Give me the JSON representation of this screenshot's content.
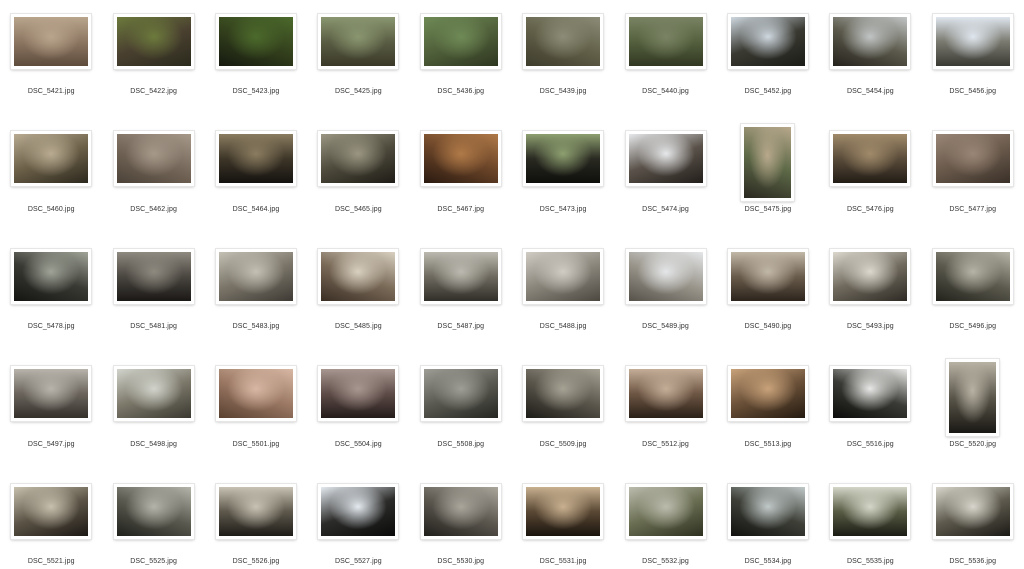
{
  "files": [
    {
      "name": "DSC_5421.jpg",
      "orientation": "landscape",
      "tone": [
        "#b9a48c",
        "#8d7763",
        "#5e4c3c"
      ]
    },
    {
      "name": "DSC_5422.jpg",
      "orientation": "landscape",
      "tone": [
        "#6c7a3c",
        "#4a4030",
        "#2a2a1c"
      ]
    },
    {
      "name": "DSC_5423.jpg",
      "orientation": "landscape",
      "tone": [
        "#4c6a2c",
        "#33401c",
        "#161a10"
      ]
    },
    {
      "name": "DSC_5425.jpg",
      "orientation": "landscape",
      "tone": [
        "#8a9670",
        "#5a5e44",
        "#3a3828"
      ]
    },
    {
      "name": "DSC_5436.jpg",
      "orientation": "landscape",
      "tone": [
        "#6f8a56",
        "#50603a",
        "#2e3620"
      ]
    },
    {
      "name": "DSC_5439.jpg",
      "orientation": "landscape",
      "tone": [
        "#8c8c78",
        "#626048",
        "#3e3c2c"
      ]
    },
    {
      "name": "DSC_5440.jpg",
      "orientation": "landscape",
      "tone": [
        "#7a8464",
        "#54603e",
        "#323822"
      ]
    },
    {
      "name": "DSC_5452.jpg",
      "orientation": "landscape",
      "tone": [
        "#cfd8e0",
        "#3a3a32",
        "#1c1c18"
      ]
    },
    {
      "name": "DSC_5454.jpg",
      "orientation": "landscape",
      "tone": [
        "#c0c4c4",
        "#5c5a4c",
        "#24221c"
      ]
    },
    {
      "name": "DSC_5456.jpg",
      "orientation": "landscape",
      "tone": [
        "#dfe6ee",
        "#7a7a70",
        "#3a3a34"
      ]
    },
    {
      "name": "DSC_5460.jpg",
      "orientation": "landscape",
      "tone": [
        "#b8ab92",
        "#6c6048",
        "#2c281e"
      ]
    },
    {
      "name": "DSC_5462.jpg",
      "orientation": "landscape",
      "tone": [
        "#a6998a",
        "#76685a",
        "#4c4238"
      ]
    },
    {
      "name": "DSC_5464.jpg",
      "orientation": "landscape",
      "tone": [
        "#8a7c60",
        "#3e3628",
        "#141210"
      ]
    },
    {
      "name": "DSC_5465.jpg",
      "orientation": "landscape",
      "tone": [
        "#9a9682",
        "#4e4a3c",
        "#1e1c16"
      ]
    },
    {
      "name": "DSC_5467.jpg",
      "orientation": "landscape",
      "tone": [
        "#b07a48",
        "#6a4428",
        "#2a1a10"
      ]
    },
    {
      "name": "DSC_5473.jpg",
      "orientation": "landscape",
      "tone": [
        "#8ea070",
        "#2a2a22",
        "#0e0e0c"
      ]
    },
    {
      "name": "DSC_5474.jpg",
      "orientation": "landscape",
      "tone": [
        "#e6e8ea",
        "#5a524a",
        "#221e1a"
      ]
    },
    {
      "name": "DSC_5475.jpg",
      "orientation": "portrait",
      "tone": [
        "#b8a88c",
        "#5e6a48",
        "#2a2820"
      ]
    },
    {
      "name": "DSC_5476.jpg",
      "orientation": "landscape",
      "tone": [
        "#a08a6a",
        "#5a4c3a",
        "#221c16"
      ]
    },
    {
      "name": "DSC_5477.jpg",
      "orientation": "landscape",
      "tone": [
        "#9a8676",
        "#6a5a4c",
        "#3a3028"
      ]
    },
    {
      "name": "DSC_5478.jpg",
      "orientation": "landscape",
      "tone": [
        "#a0a498",
        "#3a3a34",
        "#141412"
      ]
    },
    {
      "name": "DSC_5481.jpg",
      "orientation": "landscape",
      "tone": [
        "#8e8a80",
        "#4a4640",
        "#1a1816"
      ]
    },
    {
      "name": "DSC_5483.jpg",
      "orientation": "landscape",
      "tone": [
        "#c4c0b4",
        "#7a7468",
        "#3e3a34"
      ]
    },
    {
      "name": "DSC_5485.jpg",
      "orientation": "landscape",
      "tone": [
        "#d8d0c0",
        "#7a6a58",
        "#3a2e24"
      ]
    },
    {
      "name": "DSC_5487.jpg",
      "orientation": "landscape",
      "tone": [
        "#bcbab0",
        "#6e6a60",
        "#302e28"
      ]
    },
    {
      "name": "DSC_5488.jpg",
      "orientation": "landscape",
      "tone": [
        "#d0ccc4",
        "#8a867c",
        "#4c4840"
      ]
    },
    {
      "name": "DSC_5489.jpg",
      "orientation": "landscape",
      "tone": [
        "#e4e6e8",
        "#9a968c",
        "#56524a"
      ]
    },
    {
      "name": "DSC_5490.jpg",
      "orientation": "landscape",
      "tone": [
        "#c2b8a8",
        "#6a5c4c",
        "#2c241c"
      ]
    },
    {
      "name": "DSC_5493.jpg",
      "orientation": "landscape",
      "tone": [
        "#dcd8ce",
        "#706a5e",
        "#2e2a24"
      ]
    },
    {
      "name": "DSC_5496.jpg",
      "orientation": "landscape",
      "tone": [
        "#b6b4a6",
        "#5c5a4e",
        "#22221c"
      ]
    },
    {
      "name": "DSC_5497.jpg",
      "orientation": "landscape",
      "tone": [
        "#b8b4ac",
        "#6a645c",
        "#34302a"
      ]
    },
    {
      "name": "DSC_5498.jpg",
      "orientation": "landscape",
      "tone": [
        "#d2d4cc",
        "#7c786a",
        "#3a3830"
      ]
    },
    {
      "name": "DSC_5501.jpg",
      "orientation": "landscape",
      "tone": [
        "#d8b8a4",
        "#9a7864",
        "#5a4030"
      ]
    },
    {
      "name": "DSC_5504.jpg",
      "orientation": "landscape",
      "tone": [
        "#a89690",
        "#5e4c48",
        "#241c1a"
      ]
    },
    {
      "name": "DSC_5508.jpg",
      "orientation": "landscape",
      "tone": [
        "#9e9e96",
        "#5a5a52",
        "#262622"
      ]
    },
    {
      "name": "DSC_5509.jpg",
      "orientation": "landscape",
      "tone": [
        "#a6a294",
        "#5a564c",
        "#1e1c18"
      ]
    },
    {
      "name": "DSC_5512.jpg",
      "orientation": "landscape",
      "tone": [
        "#c4ae98",
        "#6e5644",
        "#2a2018"
      ]
    },
    {
      "name": "DSC_5513.jpg",
      "orientation": "landscape",
      "tone": [
        "#c8a27a",
        "#6a5038",
        "#241a10"
      ]
    },
    {
      "name": "DSC_5516.jpg",
      "orientation": "landscape",
      "tone": [
        "#e8e8e6",
        "#3a3a36",
        "#0c0c0a"
      ]
    },
    {
      "name": "DSC_5520.jpg",
      "orientation": "portrait",
      "tone": [
        "#b8b2a4",
        "#5a564a",
        "#1a1814"
      ]
    },
    {
      "name": "DSC_5521.jpg",
      "orientation": "landscape",
      "tone": [
        "#c8c0ae",
        "#5c5446",
        "#1c1814"
      ]
    },
    {
      "name": "DSC_5525.jpg",
      "orientation": "landscape",
      "tone": [
        "#b4b4aa",
        "#5a5a50",
        "#20201c"
      ]
    },
    {
      "name": "DSC_5526.jpg",
      "orientation": "landscape",
      "tone": [
        "#c8c2b4",
        "#5e584c",
        "#1e1c18"
      ]
    },
    {
      "name": "DSC_5527.jpg",
      "orientation": "landscape",
      "tone": [
        "#e4eaf0",
        "#2c2c2a",
        "#0a0a0a"
      ]
    },
    {
      "name": "DSC_5530.jpg",
      "orientation": "landscape",
      "tone": [
        "#aaa69c",
        "#5c5850",
        "#22201c"
      ]
    },
    {
      "name": "DSC_5531.jpg",
      "orientation": "landscape",
      "tone": [
        "#c8b090",
        "#5a4834",
        "#1a140e"
      ]
    },
    {
      "name": "DSC_5532.jpg",
      "orientation": "landscape",
      "tone": [
        "#bcbcae",
        "#6a6e52",
        "#2e3020"
      ]
    },
    {
      "name": "DSC_5534.jpg",
      "orientation": "landscape",
      "tone": [
        "#c0c8c8",
        "#3e4038",
        "#121210"
      ]
    },
    {
      "name": "DSC_5535.jpg",
      "orientation": "landscape",
      "tone": [
        "#d4d6c8",
        "#585c44",
        "#1a1c14"
      ]
    },
    {
      "name": "DSC_5536.jpg",
      "orientation": "landscape",
      "tone": [
        "#d8d6cc",
        "#5e5a4e",
        "#1c1a16"
      ]
    }
  ]
}
